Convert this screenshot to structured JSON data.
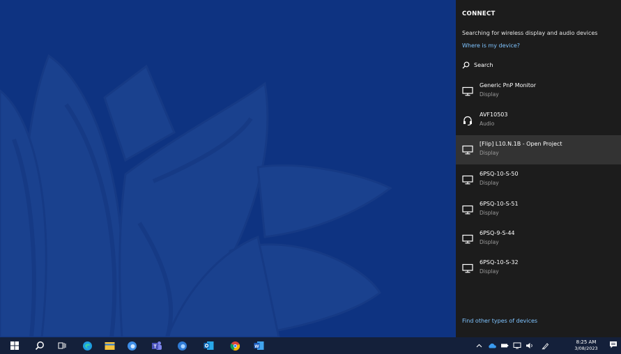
{
  "connect_panel": {
    "title": "CONNECT",
    "status": "Searching for wireless display and audio devices",
    "where_link": "Where is my device?",
    "search_label": "Search",
    "devices": [
      {
        "name": "Generic PnP Monitor",
        "type": "Display",
        "icon": "monitor-icon",
        "selected": false
      },
      {
        "name": "AVF10503",
        "type": "Audio",
        "icon": "headset-icon",
        "selected": false
      },
      {
        "name": "[Flip] L10.N.1B - Open Project",
        "type": "Display",
        "icon": "monitor-icon",
        "selected": true
      },
      {
        "name": "6PSQ-10-S-50",
        "type": "Display",
        "icon": "monitor-icon",
        "selected": false
      },
      {
        "name": "6PSQ-10-S-51",
        "type": "Display",
        "icon": "monitor-icon",
        "selected": false
      },
      {
        "name": "6PSQ-9-S-44",
        "type": "Display",
        "icon": "monitor-icon",
        "selected": false
      },
      {
        "name": "6PSQ-10-S-32",
        "type": "Display",
        "icon": "monitor-icon",
        "selected": false
      }
    ],
    "find_other_link": "Find other types of devices"
  },
  "taskbar": {
    "apps": [
      "start-icon",
      "search-icon",
      "task-view-icon",
      "edge-icon",
      "file-explorer-icon",
      "edge-dev-icon",
      "teams-icon",
      "edge-beta-icon",
      "outlook-icon",
      "chrome-icon",
      "word-icon"
    ],
    "tray": [
      "chevron-up-icon",
      "onedrive-icon",
      "battery-icon",
      "network-icon",
      "volume-icon",
      "pen-icon"
    ],
    "time": "8:25 AM",
    "date": "3/08/2023",
    "notification_icon": "action-center-icon"
  },
  "colors": {
    "desktop_bg": "#0e3381",
    "panel_bg": "#1c1c1c",
    "selected_bg": "#333333",
    "link": "#7fc4ff",
    "taskbar_bg": "#14203a"
  }
}
